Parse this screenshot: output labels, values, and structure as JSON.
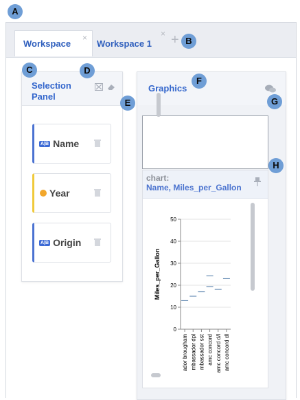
{
  "callouts": [
    "A",
    "B",
    "C",
    "D",
    "E",
    "F",
    "G",
    "H"
  ],
  "tabs": [
    {
      "label": "Workspace",
      "close": "×"
    },
    {
      "label": "Workspace 1",
      "close": "×"
    }
  ],
  "add_tab": "+",
  "selection_panel": {
    "title": "Selection Panel",
    "fields": [
      {
        "label": "Name",
        "type_badge": "A|B",
        "kind": "nominal"
      },
      {
        "label": "Year",
        "kind": "temporal"
      },
      {
        "label": "Origin",
        "type_badge": "A|B",
        "kind": "nominal"
      }
    ]
  },
  "graphics_panel": {
    "title": "Graphics",
    "chart_card": {
      "title_line1": "chart:",
      "title_line2": "Name, Miles_per_Gallon"
    }
  },
  "chart_data": {
    "type": "scatter",
    "ylabel": "Miles_per_Gallon",
    "ylim": [
      0,
      50
    ],
    "yticks": [
      0,
      10,
      20,
      30,
      40,
      50
    ],
    "categories": [
      "ador brougham",
      "mbassador dpl",
      "mbassador sst",
      "amc concord",
      "amc concord d/l",
      "amc concord dl"
    ],
    "points": [
      {
        "x": "ador brougham",
        "y": 13
      },
      {
        "x": "mbassador dpl",
        "y": 15
      },
      {
        "x": "mbassador sst",
        "y": 17
      },
      {
        "x": "amc concord",
        "y": 24.3
      },
      {
        "x": "amc concord",
        "y": 19.4
      },
      {
        "x": "amc concord d/l",
        "y": 18.1
      },
      {
        "x": "amc concord dl",
        "y": 23
      }
    ],
    "mark_color": "#4c78a8"
  }
}
